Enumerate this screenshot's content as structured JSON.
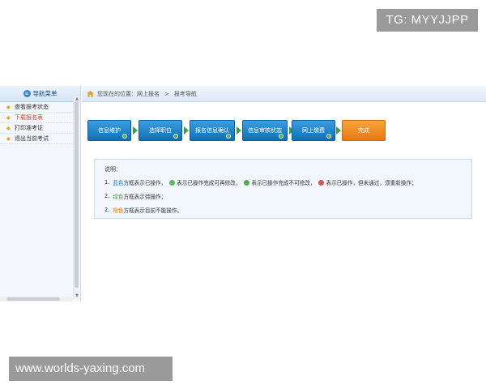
{
  "watermarks": {
    "top": "TG: MYYJJPP",
    "bottom": "www.worlds-yaxing.com"
  },
  "sidebar": {
    "title": "导航菜单",
    "items": [
      {
        "label": "查看报考状态",
        "active": false
      },
      {
        "label": "下载报名表",
        "active": true
      },
      {
        "label": "打印准考证",
        "active": false
      },
      {
        "label": "退出当前考试",
        "active": false
      }
    ]
  },
  "breadcrumb": {
    "prefix": "您现在的位置：",
    "level1": "网上报名",
    "separator": ">",
    "level2": "报考导航"
  },
  "steps": [
    {
      "label": "信息维护",
      "status": "complete"
    },
    {
      "label": "选择职位",
      "status": "complete"
    },
    {
      "label": "报名信息确认",
      "status": "complete"
    },
    {
      "label": "信息审核状态",
      "status": "complete"
    },
    {
      "label": "网上缴费",
      "status": "complete"
    },
    {
      "label": "完成",
      "status": "current"
    }
  ],
  "notes": {
    "title": "说明：",
    "line1": {
      "num": "1.",
      "color_word": "蓝色",
      "text_a": "方框表示已操作，",
      "text_b": "表示已操作完成可再修改，",
      "text_c": "表示已操作完成不可修改，",
      "text_d": "表示已操作，但未通过，须重新操作；"
    },
    "line2": {
      "num": "2.",
      "color_word": "绿色",
      "text": "方框表示待操作；"
    },
    "line3": {
      "num": "2.",
      "color_word": "橙色",
      "text": "方框表示目前不能操作。"
    }
  },
  "colors": {
    "step_blue": "#1a7fc8",
    "step_orange": "#f08c20",
    "arrow_green": "#3aa04a"
  }
}
